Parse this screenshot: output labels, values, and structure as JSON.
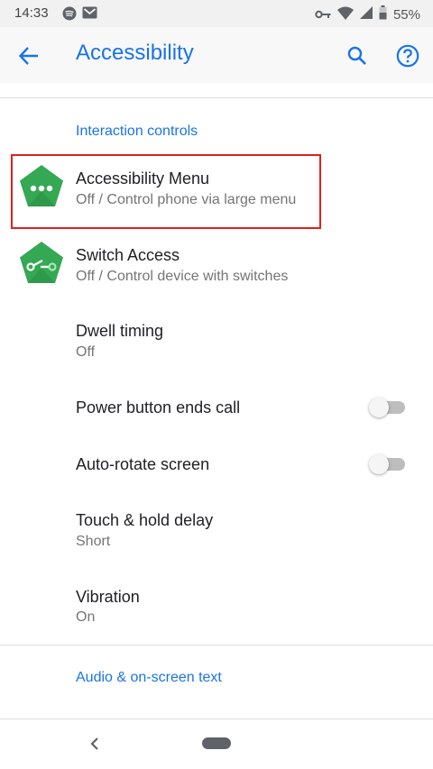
{
  "status_bar": {
    "time": "14:33",
    "battery": "55%",
    "icons": [
      "spotify-icon",
      "gmail-icon",
      "vpn-key-icon",
      "wifi-icon",
      "signal-icon",
      "battery-icon"
    ]
  },
  "app_bar": {
    "title": "Accessibility",
    "back_icon": "arrow-back-icon",
    "search_icon": "search-icon",
    "help_icon": "help-icon"
  },
  "sections": [
    {
      "header": "Interaction controls",
      "items": [
        {
          "title": "Accessibility Menu",
          "summary": "Off / Control phone via large menu",
          "icon": "accessibility-menu-icon"
        },
        {
          "title": "Switch Access",
          "summary": "Off / Control device with switches",
          "icon": "switch-access-icon"
        },
        {
          "title": "Dwell timing",
          "summary": "Off"
        },
        {
          "title": "Power button ends call",
          "toggle": false
        },
        {
          "title": "Auto-rotate screen",
          "toggle": false
        },
        {
          "title": "Touch & hold delay",
          "summary": "Short"
        },
        {
          "title": "Vibration",
          "summary": "On"
        }
      ]
    },
    {
      "header": "Audio & on-screen text"
    }
  ],
  "colors": {
    "accent": "#1a73e8",
    "icon_green": "#34a853",
    "highlight": "#e0201c"
  }
}
